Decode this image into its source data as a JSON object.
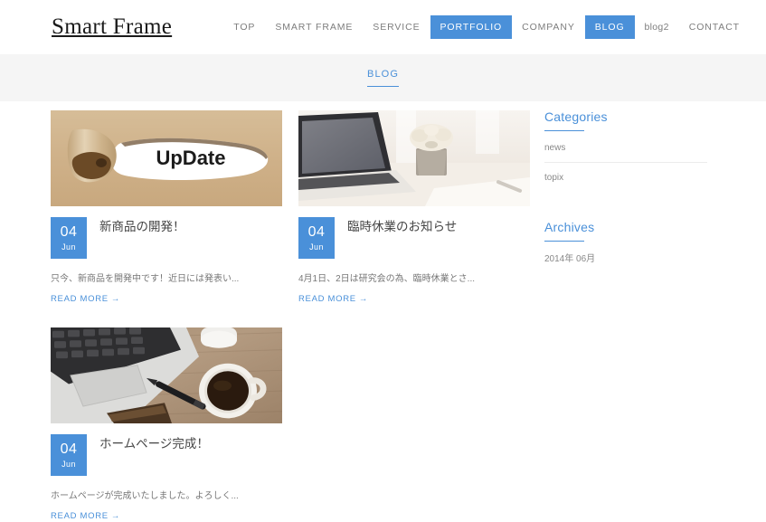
{
  "header": {
    "logo": "Smart Frame",
    "nav": [
      {
        "label": "TOP",
        "active": false,
        "lower": false
      },
      {
        "label": "SMART FRAME",
        "active": false,
        "lower": false
      },
      {
        "label": "SERVICE",
        "active": false,
        "lower": false
      },
      {
        "label": "PORTFOLIO",
        "active": true,
        "lower": false
      },
      {
        "label": "COMPANY",
        "active": false,
        "lower": false
      },
      {
        "label": "BLOG",
        "active": true,
        "lower": false
      },
      {
        "label": "blog2",
        "active": false,
        "lower": true
      },
      {
        "label": "CONTACT",
        "active": false,
        "lower": false
      }
    ]
  },
  "banner": {
    "title": "BLOG"
  },
  "posts": [
    {
      "image_alt": "torn-brown-paper-update",
      "day": "04",
      "month": "Jun",
      "title": "新商品の開発！",
      "excerpt": "只今、新商品を開発中です！近日には発表い...",
      "read_more": "READ MORE",
      "arrow": "→"
    },
    {
      "image_alt": "laptop-on-white-desk-with-flowers",
      "day": "04",
      "month": "Jun",
      "title": "臨時休業のお知らせ",
      "excerpt": "4月1日、2日は研究会の為、臨時休業とさ...",
      "read_more": "READ MORE",
      "arrow": "→"
    },
    {
      "image_alt": "laptop-pen-coffee-on-wooden-desk",
      "day": "04",
      "month": "Jun",
      "title": "ホームページ完成！",
      "excerpt": "ホームページが完成いたしました。よろしく...",
      "read_more": "READ MORE",
      "arrow": "→"
    }
  ],
  "sidebar": {
    "categories": {
      "title": "Categories",
      "items": [
        "news",
        "topix"
      ]
    },
    "archives": {
      "title": "Archives",
      "items": [
        "2014年 06月"
      ]
    }
  },
  "colors": {
    "accent": "#4a90d9",
    "banner_bg": "#f5f5f5",
    "body_text": "#777777",
    "title_text": "#444444"
  },
  "thumb1_text": "UpDate"
}
